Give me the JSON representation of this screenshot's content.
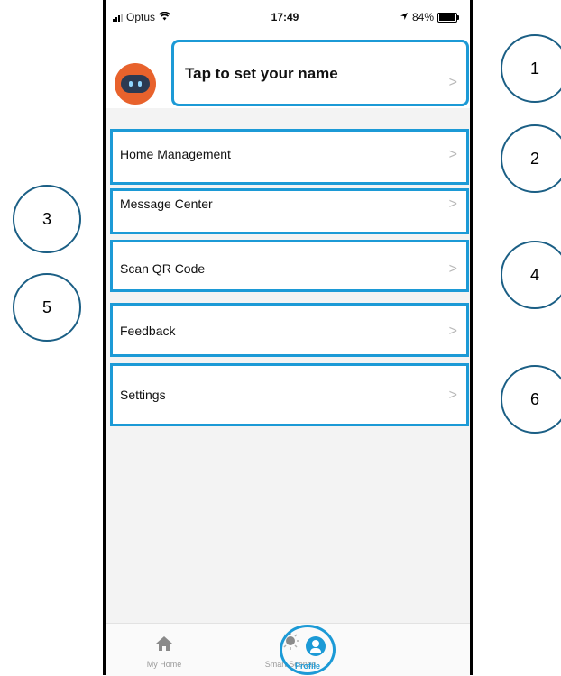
{
  "status_bar": {
    "carrier": "Optus",
    "time": "17:49",
    "battery": "84%"
  },
  "profile": {
    "name_prompt": "Tap to set your name"
  },
  "menu": [
    {
      "label": "Home Management"
    },
    {
      "label": "Message Center"
    },
    {
      "label": "Scan QR Code"
    },
    {
      "label": "Feedback"
    },
    {
      "label": "Settings"
    }
  ],
  "tabs": [
    {
      "label": "My Home",
      "icon": "home-icon"
    },
    {
      "label": "Smart Scenes",
      "icon": "sun-icon"
    },
    {
      "label": "Profile",
      "icon": "profile-icon",
      "active": true
    }
  ],
  "callouts": [
    "1",
    "2",
    "3",
    "4",
    "5",
    "6"
  ],
  "colors": {
    "accent": "#1c9ad6",
    "avatar": "#e8622c",
    "callout_border": "#1b5f85"
  },
  "chevron": ">"
}
